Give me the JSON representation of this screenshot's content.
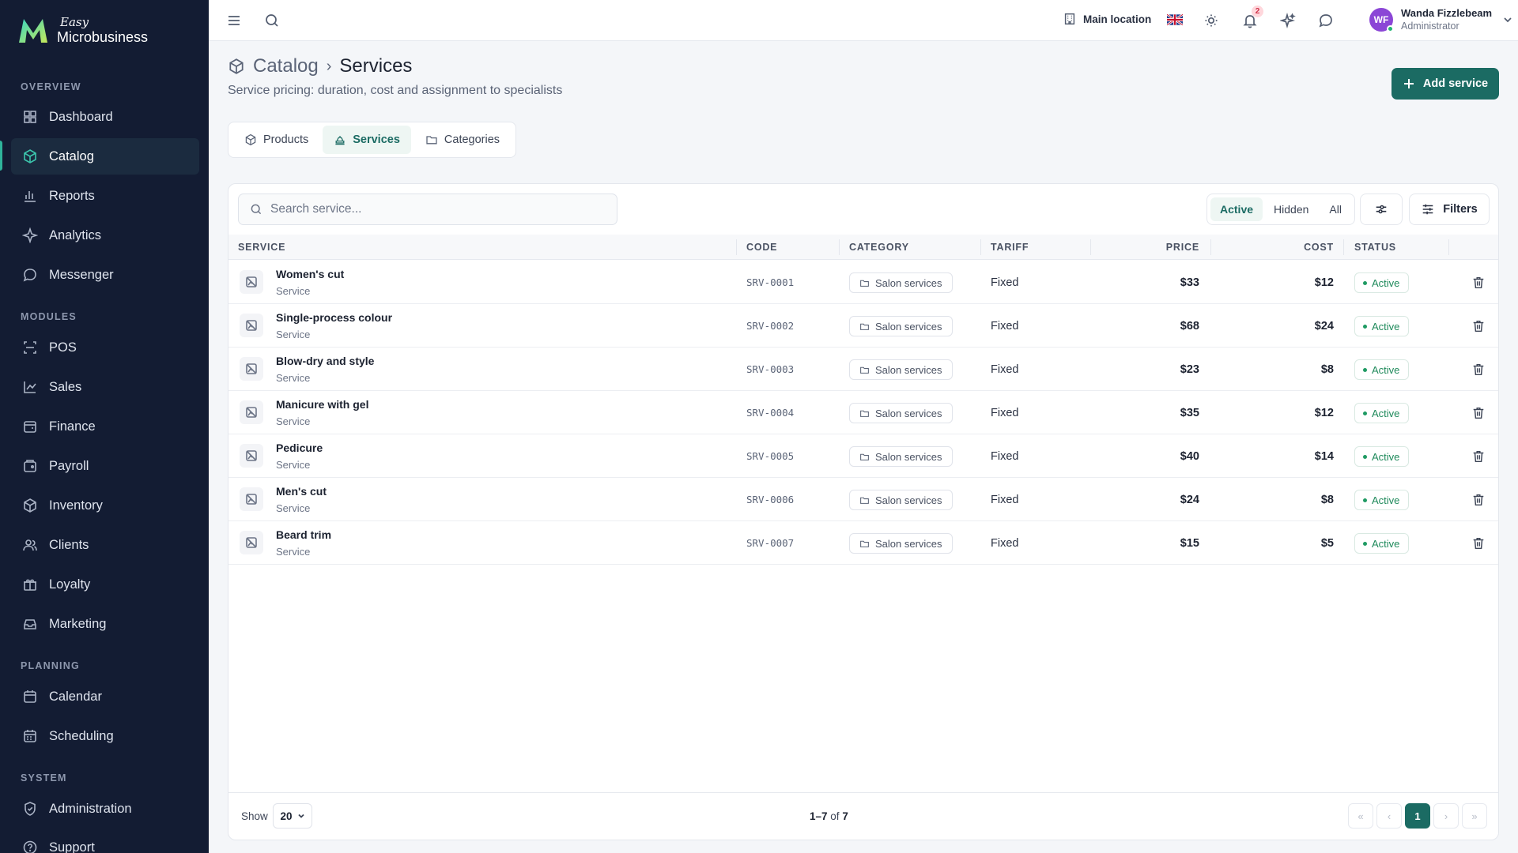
{
  "app": {
    "logo_small": "Easy",
    "logo_big": "Microbusiness"
  },
  "sidebar": {
    "sections": [
      {
        "title": "OVERVIEW",
        "items": [
          {
            "label": "Dashboard",
            "icon": "dashboard-icon"
          },
          {
            "label": "Catalog",
            "icon": "catalog-icon",
            "active": true
          },
          {
            "label": "Reports",
            "icon": "reports-icon"
          },
          {
            "label": "Analytics",
            "icon": "analytics-icon"
          },
          {
            "label": "Messenger",
            "icon": "messenger-icon"
          }
        ]
      },
      {
        "title": "MODULES",
        "items": [
          {
            "label": "POS",
            "icon": "pos-icon"
          },
          {
            "label": "Sales",
            "icon": "sales-icon"
          },
          {
            "label": "Finance",
            "icon": "finance-icon"
          },
          {
            "label": "Payroll",
            "icon": "payroll-icon"
          },
          {
            "label": "Inventory",
            "icon": "inventory-icon"
          },
          {
            "label": "Clients",
            "icon": "clients-icon"
          },
          {
            "label": "Loyalty",
            "icon": "loyalty-icon"
          },
          {
            "label": "Marketing",
            "icon": "marketing-icon"
          }
        ]
      },
      {
        "title": "PLANNING",
        "items": [
          {
            "label": "Calendar",
            "icon": "calendar-icon"
          },
          {
            "label": "Scheduling",
            "icon": "scheduling-icon"
          }
        ]
      },
      {
        "title": "SYSTEM",
        "items": [
          {
            "label": "Administration",
            "icon": "administration-icon"
          },
          {
            "label": "Support",
            "icon": "support-icon"
          }
        ]
      }
    ]
  },
  "topbar": {
    "location": "Main location",
    "notifications_count": "2",
    "user_initials": "WF",
    "user_name": "Wanda Fizzlebeam",
    "user_role": "Administrator"
  },
  "header": {
    "breadcrumb_parent": "Catalog",
    "breadcrumb_separator": "›",
    "title": "Services",
    "subtitle": "Service pricing: duration, cost and assignment to specialists",
    "add_button": "Add service"
  },
  "tabs": [
    {
      "label": "Products",
      "active": false
    },
    {
      "label": "Services",
      "active": true
    },
    {
      "label": "Categories",
      "active": false
    }
  ],
  "toolbar": {
    "search_placeholder": "Search service...",
    "status_filters": [
      {
        "label": "Active",
        "active": true
      },
      {
        "label": "Hidden",
        "active": false
      },
      {
        "label": "All",
        "active": false
      }
    ],
    "filters_label": "Filters"
  },
  "table": {
    "columns": {
      "service": "SERVICE",
      "code": "CODE",
      "category": "CATEGORY",
      "tariff": "TARIFF",
      "price": "PRICE",
      "cost": "COST",
      "status": "STATUS"
    },
    "rows": [
      {
        "name": "Women's cut",
        "type": "Service",
        "code": "SRV-0001",
        "category": "Salon services",
        "tariff": "Fixed",
        "price": "$33",
        "cost": "$12",
        "status": "Active"
      },
      {
        "name": "Single-process colour",
        "type": "Service",
        "code": "SRV-0002",
        "category": "Salon services",
        "tariff": "Fixed",
        "price": "$68",
        "cost": "$24",
        "status": "Active"
      },
      {
        "name": "Blow-dry and style",
        "type": "Service",
        "code": "SRV-0003",
        "category": "Salon services",
        "tariff": "Fixed",
        "price": "$23",
        "cost": "$8",
        "status": "Active"
      },
      {
        "name": "Manicure with gel",
        "type": "Service",
        "code": "SRV-0004",
        "category": "Salon services",
        "tariff": "Fixed",
        "price": "$35",
        "cost": "$12",
        "status": "Active"
      },
      {
        "name": "Pedicure",
        "type": "Service",
        "code": "SRV-0005",
        "category": "Salon services",
        "tariff": "Fixed",
        "price": "$40",
        "cost": "$14",
        "status": "Active"
      },
      {
        "name": "Men's cut",
        "type": "Service",
        "code": "SRV-0006",
        "category": "Salon services",
        "tariff": "Fixed",
        "price": "$24",
        "cost": "$8",
        "status": "Active"
      },
      {
        "name": "Beard trim",
        "type": "Service",
        "code": "SRV-0007",
        "category": "Salon services",
        "tariff": "Fixed",
        "price": "$15",
        "cost": "$5",
        "status": "Active"
      }
    ]
  },
  "footer": {
    "show_label": "Show",
    "page_size": "20",
    "range": "1–7",
    "of_label": "of",
    "total": "7",
    "current_page": "1"
  },
  "colors": {
    "sidebar_bg": "#131c33",
    "accent": "#1b6b63",
    "status_active": "#1f8a5b"
  }
}
